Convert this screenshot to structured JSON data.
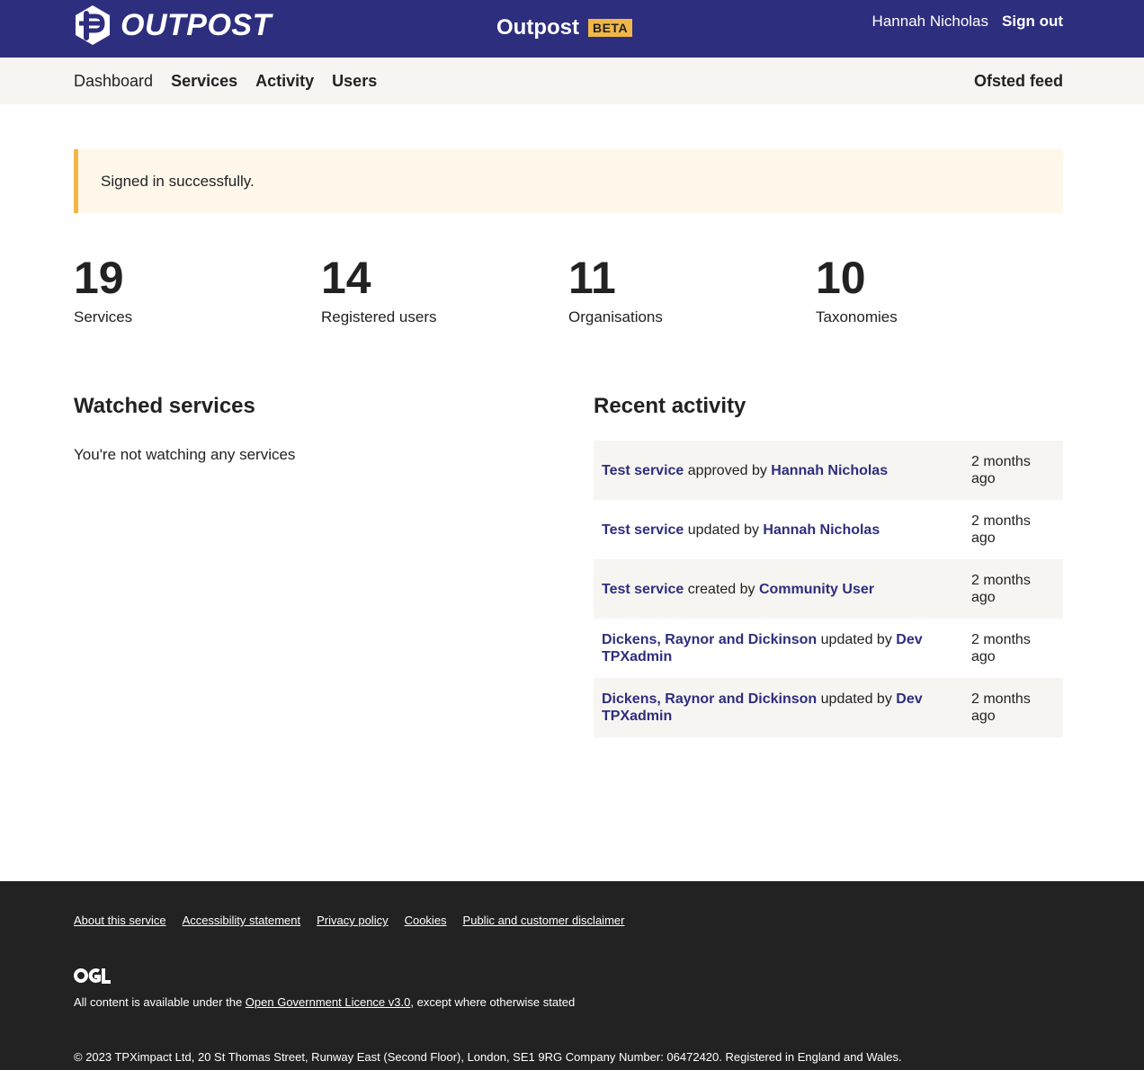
{
  "header": {
    "logo_text": "OUTPOST",
    "service_name": "Outpost",
    "badge": "BETA",
    "user_name": "Hannah Nicholas",
    "sign_out": "Sign out"
  },
  "nav": {
    "items": [
      "Dashboard",
      "Services",
      "Activity",
      "Users"
    ],
    "right_link": "Ofsted feed"
  },
  "alert": {
    "message": "Signed in successfully."
  },
  "stats": [
    {
      "value": "19",
      "label": "Services"
    },
    {
      "value": "14",
      "label": "Registered users"
    },
    {
      "value": "11",
      "label": "Organisations"
    },
    {
      "value": "10",
      "label": "Taxonomies"
    }
  ],
  "watched": {
    "heading": "Watched services",
    "empty_message": "You're not watching any services"
  },
  "recent": {
    "heading": "Recent activity",
    "rows": [
      {
        "subject": "Test service",
        "action": "approved by",
        "actor": "Hannah Nicholas",
        "time": "2 months ago"
      },
      {
        "subject": "Test service",
        "action": "updated by",
        "actor": "Hannah Nicholas",
        "time": "2 months ago"
      },
      {
        "subject": "Test service",
        "action": "created by",
        "actor": "Community User",
        "time": "2 months ago"
      },
      {
        "subject": "Dickens, Raynor and Dickinson",
        "action": "updated by",
        "actor": "Dev TPXadmin",
        "time": "2 months ago"
      },
      {
        "subject": "Dickens, Raynor and Dickinson",
        "action": "updated by",
        "actor": "Dev TPXadmin",
        "time": "2 months ago"
      }
    ]
  },
  "footer": {
    "links": [
      "About this service",
      "Accessibility statement",
      "Privacy policy",
      "Cookies",
      "Public and customer disclaimer"
    ],
    "ogl_logo": "OGL",
    "licence_prefix": "All content is available under the ",
    "licence_link": "Open Government Licence v3.0",
    "licence_suffix": ", except where otherwise stated",
    "copyright": "© 2023 TPXimpact Ltd, 20 St Thomas Street, Runway East (Second Floor), London, SE1 9RG Company Number: 06472420. Registered in England and Wales."
  },
  "colors": {
    "brand": "#2e2e7e",
    "accent": "#f0b748",
    "subnav_bg": "#f6f5f1",
    "alert_bg": "#fff7ea",
    "footer_bg": "#222222"
  }
}
